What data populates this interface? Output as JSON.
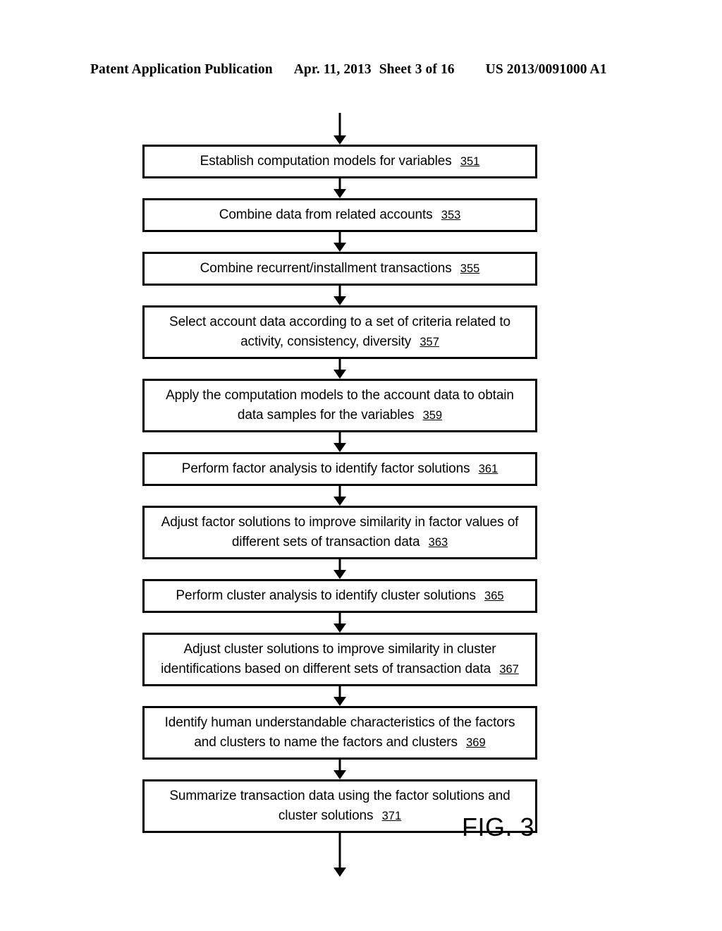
{
  "header": {
    "publication": "Patent Application Publication",
    "date": "Apr. 11, 2013",
    "sheet": "Sheet 3 of 16",
    "patent_number": "US 2013/0091000 A1"
  },
  "figure": {
    "label": "FIG. 3",
    "type": "flowchart",
    "nodes": [
      {
        "text": "Establish computation models for variables",
        "ref": "351"
      },
      {
        "text": "Combine data from related accounts",
        "ref": "353"
      },
      {
        "text": "Combine recurrent/installment transactions",
        "ref": "355"
      },
      {
        "text": "Select account data according to a set of criteria related to activity, consistency, diversity",
        "ref": "357"
      },
      {
        "text": "Apply the computation models to the account data to obtain data samples for the variables",
        "ref": "359"
      },
      {
        "text": "Perform factor analysis to identify factor solutions",
        "ref": "361"
      },
      {
        "text": "Adjust factor solutions to improve similarity in factor values of different sets of transaction data",
        "ref": "363"
      },
      {
        "text": "Perform cluster analysis to identify cluster solutions",
        "ref": "365"
      },
      {
        "text": "Adjust cluster solutions to improve similarity in cluster identifications based on different sets of transaction data",
        "ref": "367"
      },
      {
        "text": "Identify human understandable characteristics of the factors and clusters to name the factors and clusters",
        "ref": "369"
      },
      {
        "text": "Summarize transaction data using the factor solutions and cluster solutions",
        "ref": "371"
      }
    ]
  },
  "colors": {
    "ink": "#000000",
    "paper": "#ffffff"
  }
}
